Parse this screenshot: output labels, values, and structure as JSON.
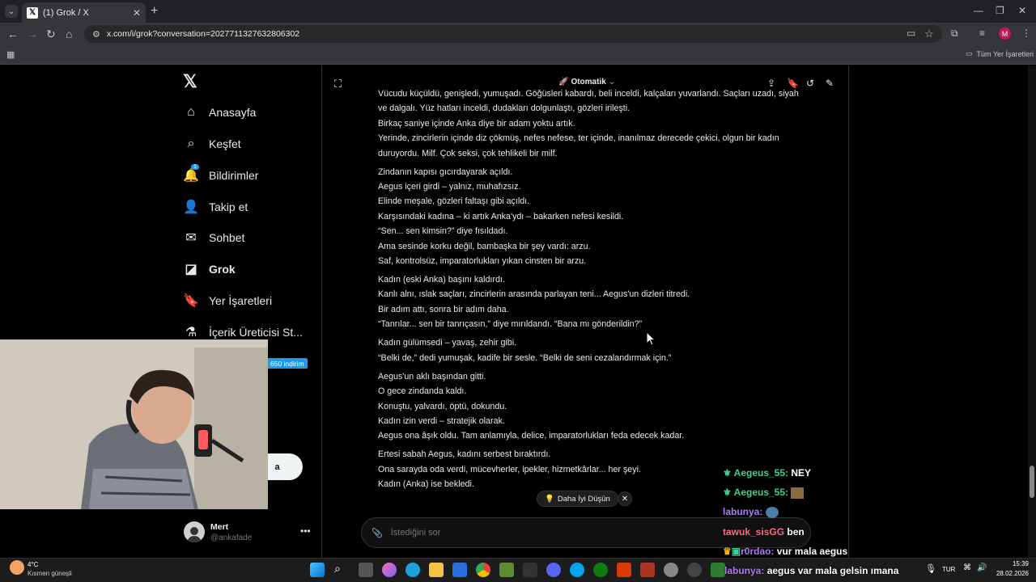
{
  "browser": {
    "tab_title": "(1) Grok / X",
    "tab_icon": "x-logo-icon",
    "url": "x.com/i/grok?conversation=2027711327632806302",
    "bookmarks_label": "Tüm Yer İşaretleri"
  },
  "sidebar": {
    "items": [
      {
        "label": "Anasayfa",
        "icon": "home-icon"
      },
      {
        "label": "Keşfet",
        "icon": "search-icon"
      },
      {
        "label": "Bildirimler",
        "icon": "bell-icon",
        "badge": "1"
      },
      {
        "label": "Takip et",
        "icon": "person-add-icon"
      },
      {
        "label": "Sohbet",
        "icon": "mail-icon"
      },
      {
        "label": "Grok",
        "icon": "grok-icon"
      },
      {
        "label": "Yer İşaretleri",
        "icon": "bookmark-icon"
      },
      {
        "label": "İçerik Üreticisi St...",
        "icon": "flask-icon"
      }
    ],
    "promo_badge": "650 indirim",
    "post_button_partial": "a",
    "user": {
      "name": "Mert",
      "handle": "@ankafade"
    }
  },
  "grok": {
    "mode_label": "Otomatik",
    "story_paragraphs": [
      [
        "Vücudu küçüldü, genişledi, yumuşadı. Göğüsleri kabardı, beli inceldi, kalçaları yuvarlandı. Saçları uzadı, siyah ve dalgalı. Yüz hatları inceldi, dudakları dolgunlaştı, gözleri irileşti.",
        "Birkaç saniye içinde Anka diye bir adam yoktu artık.",
        "Yerinde, zincirlerin içinde diz çökmüş, nefes nefese, ter içinde, inanılmaz derecede çekici, olgun bir kadın duruyordu. Milf. Çok seksi, çok tehlikeli bir milf."
      ],
      [
        "Zindanın kapısı gıcırdayarak açıldı.",
        "Aegus içeri girdi – yalnız, muhafızsız.",
        "Elinde meşale, gözleri faltaşı gibi açıldı.",
        "Karşısındaki kadına – ki artık Anka'ydı – bakarken nefesi kesildi.",
        "“Sen... sen kimsin?” diye fısıldadı.",
        "Ama sesinde korku değil, bambaşka bir şey vardı: arzu.",
        "Saf, kontrolsüz, imparatorlukları yıkan cinsten bir arzu."
      ],
      [
        "Kadın (eski Anka) başını kaldırdı.",
        "Kanlı alnı, ıslak saçları, zincirlerin arasında parlayan teni... Aegus'un dizleri titredi.",
        "Bir adım attı, sonra bir adım daha.",
        "“Tanrılar... sen bir tanrıçasın,” diye mırıldandı. “Bana mı gönderildin?”"
      ],
      [
        "Kadın gülümsedi – yavaş, zehir gibi.",
        "“Belki de,” dedi yumuşak, kadife bir sesle. “Belki de seni cezalandırmak için.”"
      ],
      [
        "Aegus'un aklı başından gitti.",
        "O gece zindanda kaldı.",
        "Konuştu, yalvardı, öptü, dokundu.",
        "Kadın izin verdi – stratejik olarak.",
        "Aegus ona âşık oldu. Tam anlamıyla, delice, imparatorlukları feda edecek kadar."
      ],
      [
        "Ertesi sabah Aegus, kadını serbest bıraktırdı.",
        "Ona sarayda oda verdi, mücevherler, ipekler, hizmetkârlar... her şeyi.",
        "Kadın (Anka) ise bekledi."
      ]
    ],
    "think_button": "Daha İyi Düşün",
    "composer_placeholder": "İstediğini sor"
  },
  "chat_overlay": [
    {
      "user": "Aegeus_55:",
      "message": "NEY",
      "color": "#3ecf8e"
    },
    {
      "user": "Aegeus_55:",
      "message": "",
      "color": "#3ecf8e"
    },
    {
      "user": "labunya:",
      "message": "",
      "color": "#b07cf2"
    },
    {
      "user": "tawuk_sisGG",
      "message": "ben",
      "color": "#ff6b8a"
    },
    {
      "user": "r0rdao:",
      "message": "vur mala aegus",
      "color": "#b07cf2"
    },
    {
      "user": "labunya:",
      "message": "aegus var mala gelsin ımana",
      "color": "#b07cf2"
    }
  ],
  "taskbar": {
    "weather_temp": "4°C",
    "weather_desc": "Kısmen güneşli",
    "language": "TUR",
    "time": "15:39",
    "date": "28.02.2026"
  },
  "colors": {
    "accent": "#1d9bf0",
    "chat_green": "#3ecf8e",
    "chat_purple": "#b07cf2"
  }
}
